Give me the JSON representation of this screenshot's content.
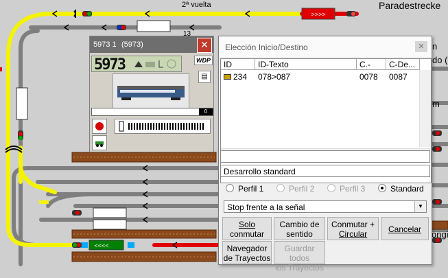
{
  "layout_labels": {
    "vuelta": "2ª vuelta",
    "station": "Paradestrecke",
    "frag_n": "n",
    "frag_do": "do (",
    "frag_m": "m",
    "frag_ongit": "ongit",
    "frag_num": "13",
    "arrow_sign": ">>>>",
    "arrow_sign_left": "<<<<"
  },
  "loco_window": {
    "id_label": "5973 1",
    "id_paren": "(5973)",
    "display_number": "5973",
    "speed_value": "0",
    "logo": "WDP"
  },
  "route_dialog": {
    "title": "Elección Inicio/Destino",
    "columns": [
      "ID",
      "ID-Texto",
      "C.-Ini...",
      "C-De..."
    ],
    "rows": [
      {
        "id": "234",
        "text": "078>087",
        "start": "0078",
        "dest": "0087"
      }
    ],
    "text_field": "",
    "description_field": "Desarrollo standard",
    "profiles": [
      {
        "label": "Perfil 1",
        "selected": false,
        "enabled": true
      },
      {
        "label": "Perfil 2",
        "selected": false,
        "enabled": false
      },
      {
        "label": "Perfil 3",
        "selected": false,
        "enabled": false
      },
      {
        "label": "Standard",
        "selected": true,
        "enabled": true
      }
    ],
    "stop_option": "Stop frente a la señal",
    "buttons": {
      "solo_conmutar_1": "Solo",
      "solo_conmutar_2": "conmutar",
      "cambio_sentido_1": "Cambio de",
      "cambio_sentido_2": "sentido",
      "conmutar_circular_1": "Conmutar +",
      "conmutar_circular_2": "Circular",
      "cancelar": "Cancelar",
      "navegador_1": "Navegador",
      "navegador_2": "de Trayectos",
      "guardar_1": "Guardar todos",
      "guardar_2": "los Trayectos"
    }
  },
  "colors": {
    "track_gray": "#7f7f7f",
    "track_yellow": "#f4f400",
    "track_red": "#e00000",
    "platform_brown": "#8b4a1c",
    "occupied_green": "#008000"
  }
}
